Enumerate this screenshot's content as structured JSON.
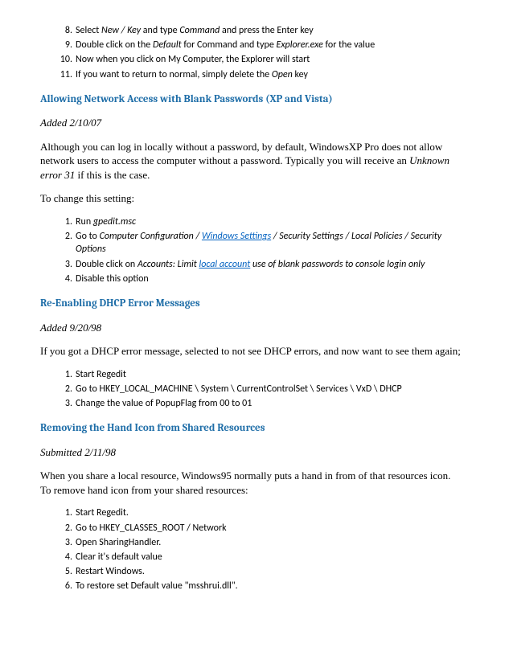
{
  "topList": [
    {
      "num": "8.",
      "prefix": "Select ",
      "em1": "New / Key",
      "mid": " and type ",
      "em2": "Command",
      "suffix": " and press the Enter key"
    },
    {
      "num": "9.",
      "prefix": "Double click on the ",
      "em1": "Default",
      "mid": " for Command and type ",
      "em2": "Explorer.exe",
      "suffix": " for the value"
    },
    {
      "num": "10.",
      "plain": "Now when you click on My Computer, the Explorer will start"
    },
    {
      "num": "11.",
      "prefix": "If you want to return to normal, simply delete the ",
      "em1": "Open",
      "suffix": " key"
    }
  ],
  "section1": {
    "heading": "Allowing Network Access with Blank Passwords (XP and Vista)",
    "date": "Added 2/10/07",
    "para1a": "Although you can log in locally without a password, by default, WindowsXP Pro does not allow network users to access the computer without a password. Typically you will receive an ",
    "para1b": "Unknown error 31",
    "para1c": " if this is the case.",
    "para2": "To change this setting:",
    "items": [
      {
        "num": "1.",
        "prefix": "Run ",
        "em1": "gpedit.msc"
      },
      {
        "num": "2.",
        "prefix": "Go to ",
        "em1": "Computer Configuration / ",
        "link": "Windows Settings",
        "em2": " / Security Settings / Local Policies / Security Options"
      },
      {
        "num": "3.",
        "prefix": "Double click on ",
        "em1": "Accounts: Limit ",
        "link": "local account",
        "em2": " use of blank passwords to console login only"
      },
      {
        "num": "4.",
        "plain": "Disable this option"
      }
    ]
  },
  "section2": {
    "heading": "Re-Enabling DHCP Error Messages",
    "date": "Added 9/20/98",
    "para": "If you got a DHCP error message, selected to not see DHCP errors, and now want to see them again;",
    "items": [
      {
        "num": "1.",
        "plain": "Start Regedit"
      },
      {
        "num": "2.",
        "plain": "Go to HKEY_LOCAL_MACHINE \\ System \\ CurrentControlSet \\ Services \\ VxD \\ DHCP"
      },
      {
        "num": "3.",
        "plain": "Change the value of PopupFlag from 00 to 01"
      }
    ]
  },
  "section3": {
    "heading": "Removing the Hand Icon from Shared Resources",
    "date": "Submitted 2/11/98",
    "para1": "When you share a local resource, Windows95 normally puts a hand in from of that resources icon.",
    "para2": "To remove hand icon from your shared resources:",
    "items": [
      {
        "num": "1.",
        "plain": "Start Regedit."
      },
      {
        "num": "2.",
        "plain": "Go to HKEY_CLASSES_ROOT / Network"
      },
      {
        "num": "3.",
        "plain": "Open SharingHandler."
      },
      {
        "num": "4.",
        "plain": "Clear it's default value"
      },
      {
        "num": "5.",
        "plain": "Restart Windows."
      },
      {
        "num": "6.",
        "plain": "To restore set Default value \"msshrui.dll\"."
      }
    ]
  }
}
